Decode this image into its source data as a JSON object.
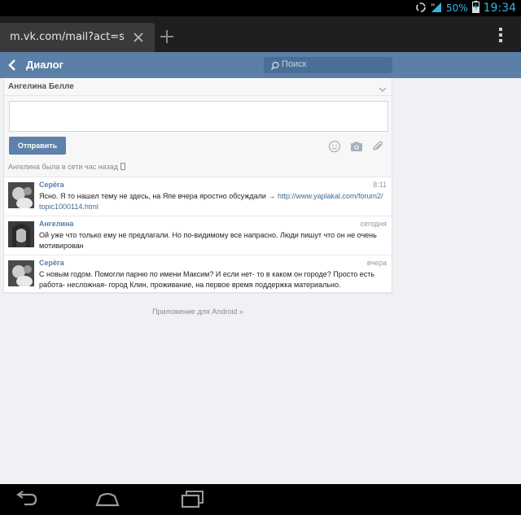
{
  "status_bar": {
    "battery_percent": "50%",
    "time": "19:34"
  },
  "browser": {
    "tab_title": "m.vk.com/mail?act=show&..."
  },
  "header": {
    "title": "Диалог",
    "search_placeholder": "Поиск"
  },
  "dialog": {
    "recipient_name": "Ангелина Белле",
    "send_label": "Отправить",
    "online_status": "Ангелина была в сети час назад"
  },
  "messages": [
    {
      "author": "Серёга",
      "time": "8:11",
      "text": "Ясно. Я то нашел тему не здесь, на Япе вчера яростно обсуждали → ",
      "link": "http://www.yaplakal.com/forum2/ topic1000114.html"
    },
    {
      "author": "Ангелина",
      "time": "сегодня",
      "text": "Ой уже что только ему не предлагали. Но по-видимому все напрасно. Люди пишут что он не очень мотивирован"
    },
    {
      "author": "Серёга",
      "time": "вчера",
      "text": "С новым годом. Помогли парню по имени Максим? И если нет- то в каком он городе? Просто есть работа- несложная- город Клин, проживание, на первое время поддержка материально."
    }
  ],
  "footer": {
    "android_link": "Приложение для Android »"
  },
  "colors": {
    "header_bg": "#5b7fa6",
    "accent": "#5d81a9",
    "status_blue": "#33b5e5"
  }
}
